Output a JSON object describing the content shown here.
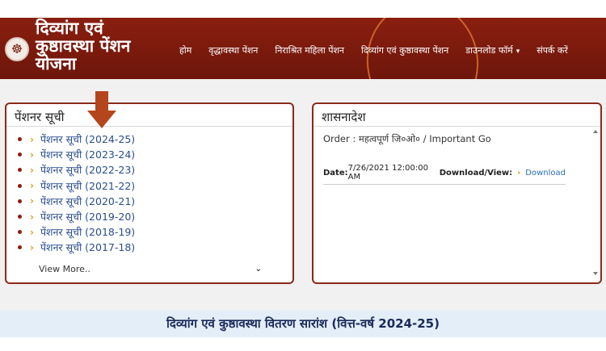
{
  "header": {
    "brand_line1": "दिव्यांग एवं",
    "brand_line2": "कुष्ठावस्था पेंशन",
    "brand_line3": "योजना",
    "nav": [
      {
        "label": "होम"
      },
      {
        "label": "वृद्धावस्था पेंशन"
      },
      {
        "label": "निराश्रित महिला पेंशन"
      },
      {
        "label": "दिव्यांग एवं कुष्ठावस्था पेंशन"
      },
      {
        "label": "डाउनलोड फॉर्म"
      },
      {
        "label": "संपर्क करें"
      }
    ]
  },
  "pension_list": {
    "title": "पेंशनर सूची",
    "items": [
      {
        "label": "पेंशनर सूची (2024-25)"
      },
      {
        "label": "पेंशनर सूची (2023-24)"
      },
      {
        "label": "पेंशनर सूची (2022-23)"
      },
      {
        "label": "पेंशनर सूची (2021-22)"
      },
      {
        "label": "पेंशनर सूची (2020-21)"
      },
      {
        "label": "पेंशनर सूची (2019-20)"
      },
      {
        "label": "पेंशनर सूची (2018-19)"
      },
      {
        "label": "पेंशनर सूची (2017-18)"
      }
    ],
    "view_more": "View More.."
  },
  "shasanadesh": {
    "title": "शासनादेश",
    "order_label": "Order :",
    "order_value": "महत्वपूर्ण जि०ओ० / Important Go",
    "date_label": "Date:",
    "date_value": "7/26/2021 12:00:00 AM",
    "download_label": "Download/View:",
    "download_link": "Download"
  },
  "summary": {
    "title": "दिव्यांग एवं कुष्ठावस्था वितरण सारांश (वित्त-वर्ष 2024-25)"
  },
  "colors": {
    "header_bg": "#7a1a0d",
    "panel_border": "#8a2a1c",
    "link": "#2a4d8f",
    "accent_arrow": "#b5461b",
    "summary_bg": "#e3eef8"
  }
}
